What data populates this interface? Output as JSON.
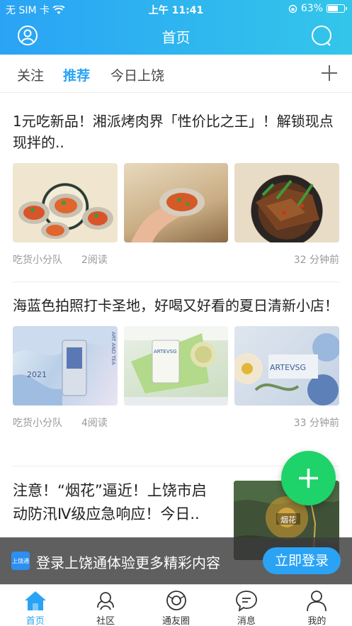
{
  "status_bar": {
    "carrier": "无 SIM 卡",
    "time": "上午 11:41",
    "battery": "63%"
  },
  "header": {
    "title": "首页"
  },
  "tabs": [
    {
      "label": "关注",
      "active": false
    },
    {
      "label": "推荐",
      "active": true
    },
    {
      "label": "今日上饶",
      "active": false
    }
  ],
  "articles": [
    {
      "title": "1元吃新品！湘派烤肉界「性价比之王」！解锁现点现拌的..",
      "source": "吃货小分队",
      "reads": "2阅读",
      "time": "32 分钟前"
    },
    {
      "title": "海蓝色拍照打卡圣地，好喝又好看的夏日清新小店！",
      "source": "吃货小分队",
      "reads": "4阅读",
      "time": "33 分钟前",
      "image_texts": [
        "ART AND TEA",
        "2021",
        "ARTEVSG"
      ]
    },
    {
      "title": "注意！“烟花”逼近！上饶市启动防汛Ⅳ级应急响应！今日..",
      "map_label": "烟花"
    }
  ],
  "banner": {
    "logo": "上饶通",
    "text": "登录上饶通体验更多精彩内容",
    "button": "立即登录"
  },
  "tabbar": [
    {
      "label": "首页",
      "icon": "home-icon",
      "active": true
    },
    {
      "label": "社区",
      "icon": "community-icon",
      "active": false
    },
    {
      "label": "通友圈",
      "icon": "friends-circle-icon",
      "active": false
    },
    {
      "label": "消息",
      "icon": "message-icon",
      "active": false
    },
    {
      "label": "我的",
      "icon": "profile-icon",
      "active": false
    }
  ],
  "colors": {
    "accent": "#2aa3f5",
    "fab": "#1ed36a"
  }
}
